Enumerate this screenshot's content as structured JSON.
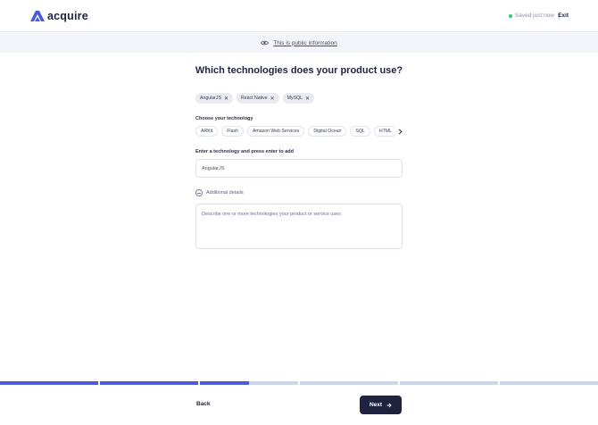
{
  "header": {
    "brand": "acquire",
    "status": "Saved just now",
    "exit_label": "Exit"
  },
  "public_bar": {
    "text": "This is public information"
  },
  "main": {
    "title": "Which technologies does your product use?",
    "selected": [
      {
        "label": "AngularJS"
      },
      {
        "label": "React Native"
      },
      {
        "label": "MySQL"
      }
    ],
    "choose_label": "Choose your technology",
    "options": [
      "ARKit",
      "Flash",
      "Amazon Web Services",
      "Digital Ocean",
      "SQL",
      "HTML"
    ],
    "input_label": "Enter a technology and press enter to add",
    "input_value": "AngularJS",
    "details_label": "Additional details",
    "textarea_placeholder": "Describe one or more technologies your product or service uses"
  },
  "progress": {
    "segments": [
      1,
      1,
      0.5,
      0,
      0,
      0
    ]
  },
  "footer": {
    "back_label": "Back",
    "next_label": "Next"
  },
  "colors": {
    "brand": "#4a5bd4",
    "dark": "#1f2340",
    "progress_track": "#c8d6ee",
    "saved_dot": "#2ecc71"
  },
  "icons": {
    "logo": "acquire-logo-icon",
    "public": "eye-icon",
    "remove": "close-icon",
    "scroll": "chevron-right-icon",
    "details": "minus-circle-icon",
    "next": "arrow-right-icon"
  }
}
